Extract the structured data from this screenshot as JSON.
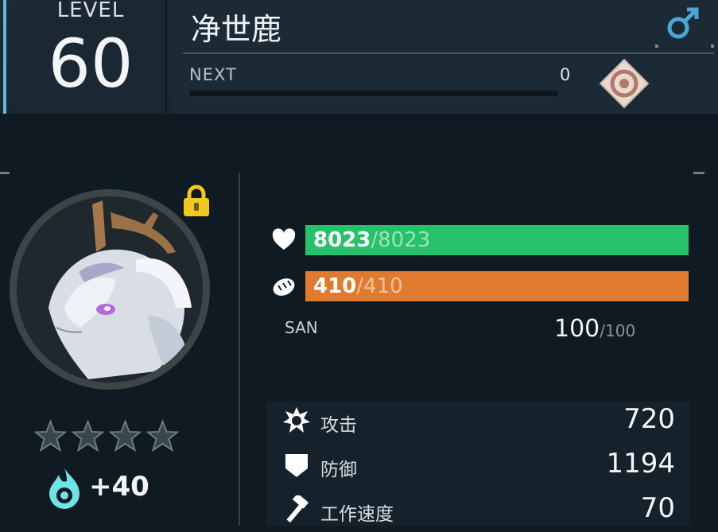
{
  "level": {
    "label": "LEVEL",
    "value": "60"
  },
  "pal": {
    "name": "净世鹿",
    "gender_icon": "male-icon",
    "element_icon": "neutral-element-icon"
  },
  "exp": {
    "next_label": "NEXT",
    "next_value": "0",
    "progress": 0
  },
  "status": {
    "locked": true,
    "lock_icon": "lock-icon",
    "stars": 0,
    "stars_max": 4
  },
  "soul": {
    "icon": "soul-flame-icon",
    "value": "+40"
  },
  "hp": {
    "icon": "heart-icon",
    "current": "8023",
    "max": "/8023",
    "fraction": 1.0,
    "color": "#27c06b"
  },
  "hunger": {
    "icon": "bread-icon",
    "current": "410",
    "max": "/410",
    "fraction": 1.0,
    "color": "#e07a2e"
  },
  "san": {
    "label": "SAN",
    "current": "100",
    "max": "/100"
  },
  "stats": [
    {
      "icon": "attack-icon",
      "label": "攻击",
      "value": "720"
    },
    {
      "icon": "defense-shield-icon",
      "label": "防御",
      "value": "1194"
    },
    {
      "icon": "work-speed-hammer-icon",
      "label": "工作速度",
      "value": "70"
    }
  ]
}
